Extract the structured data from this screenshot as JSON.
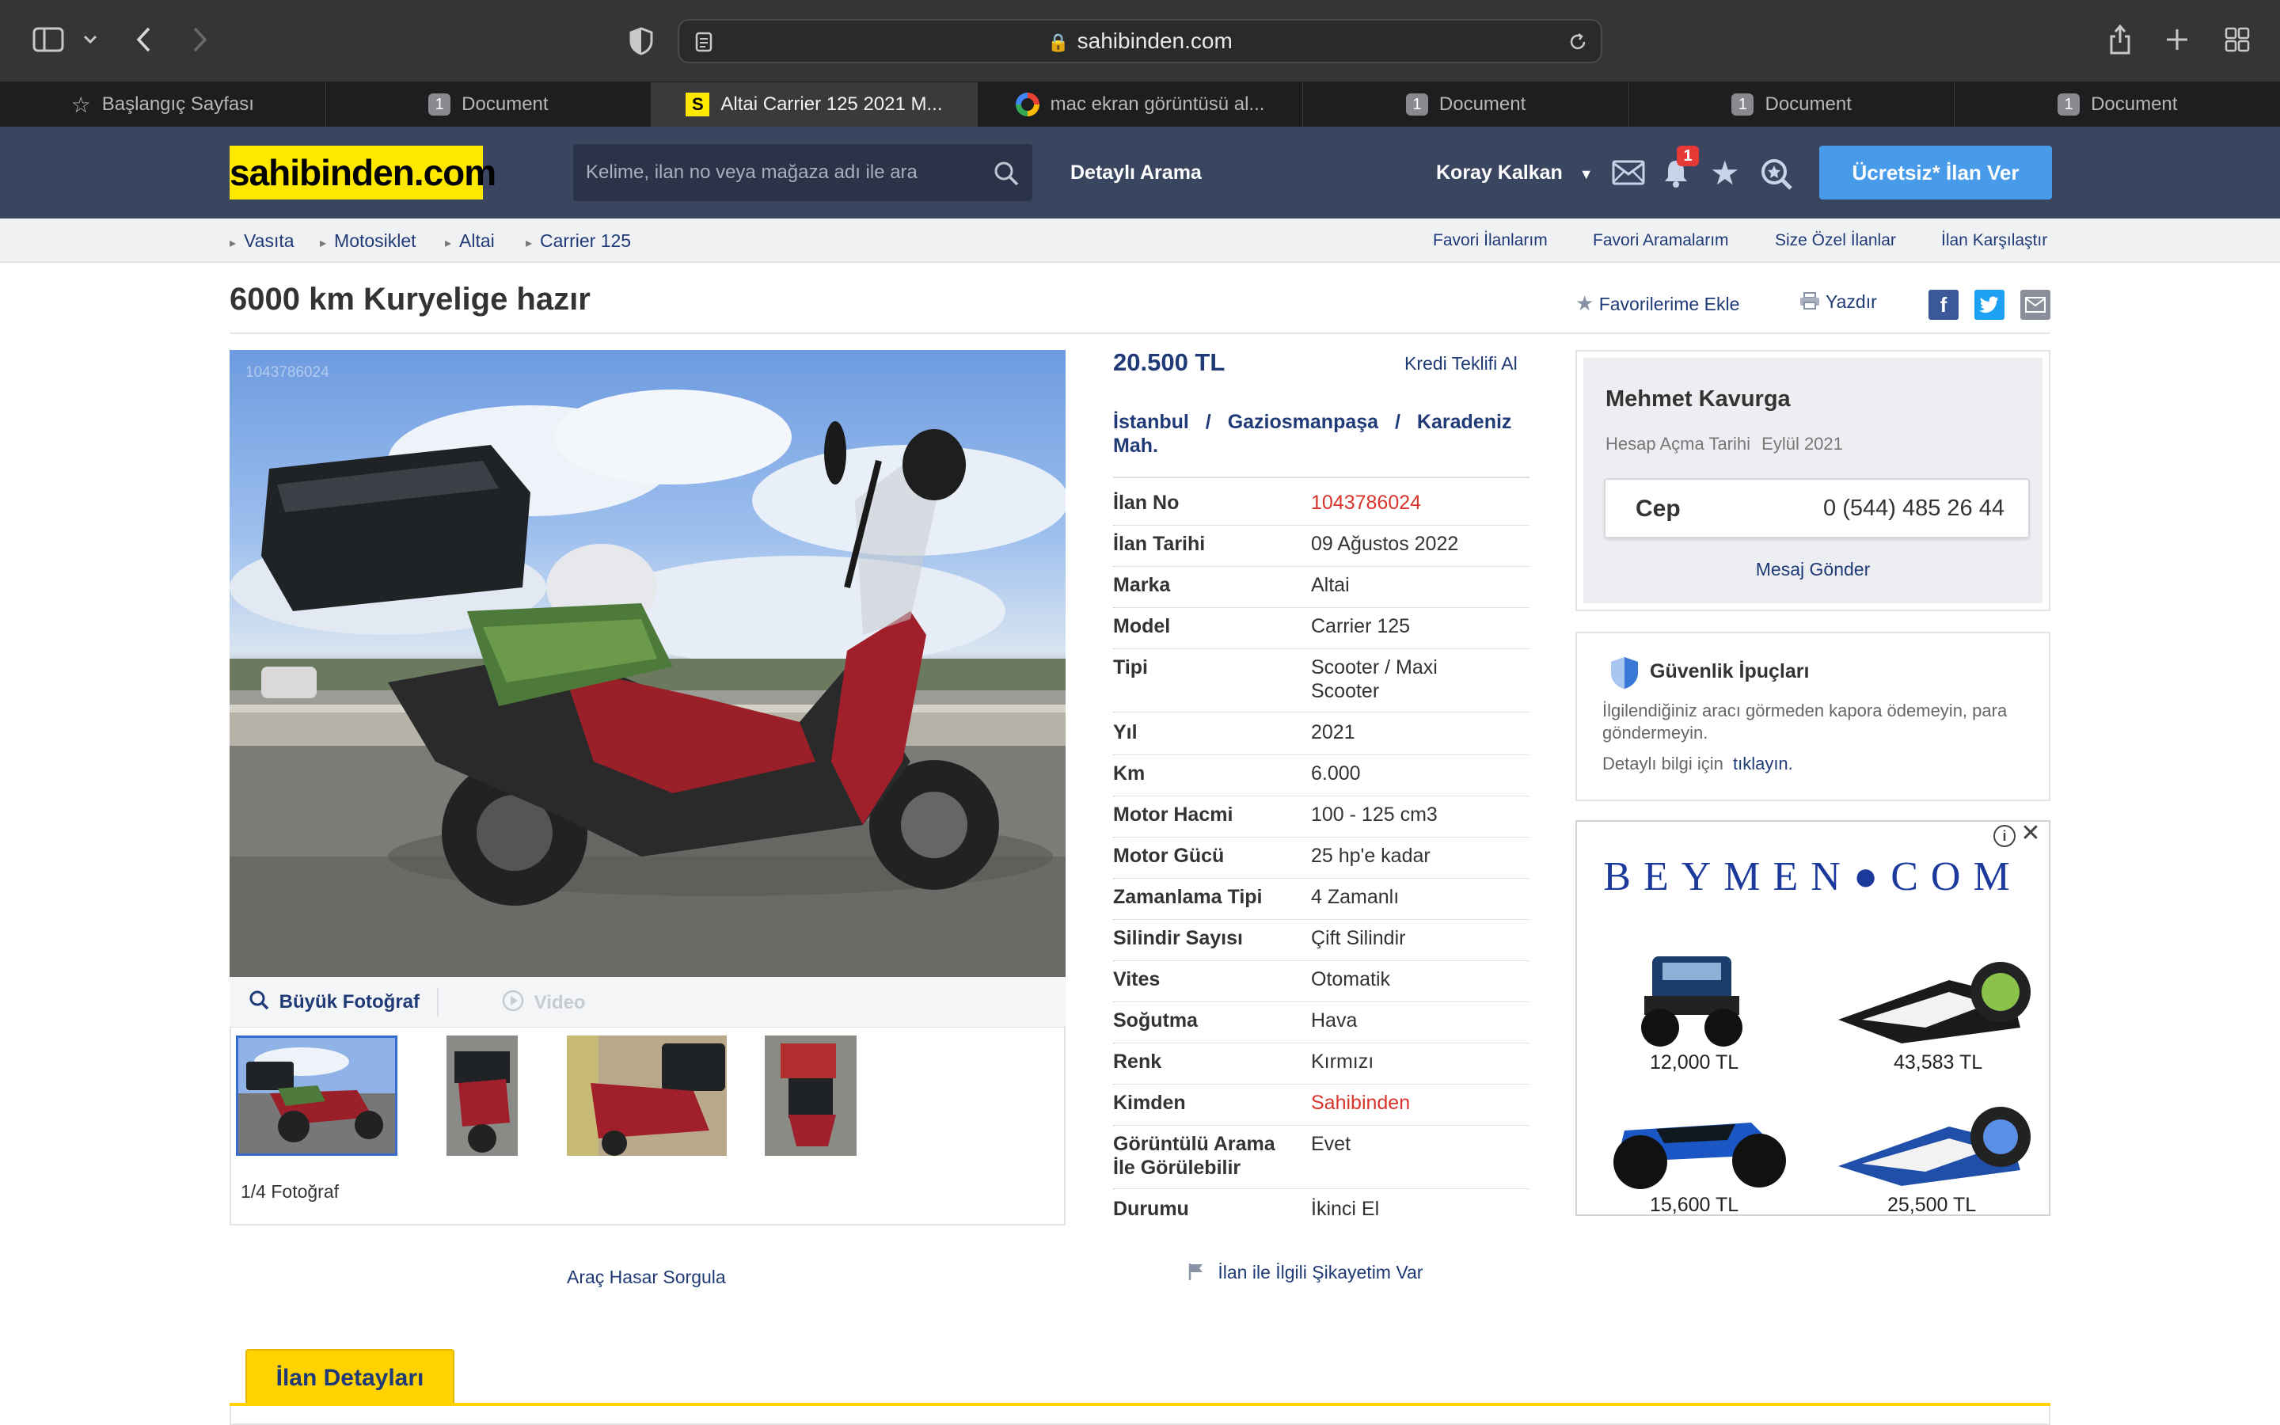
{
  "browser": {
    "url": "sahibinden.com",
    "tabs": [
      {
        "label": "Başlangıç Sayfası",
        "icon": "star-icon",
        "badge": ""
      },
      {
        "label": "Document",
        "icon": "badge",
        "badge": "1"
      },
      {
        "label": "Altai Carrier 125 2021 M...",
        "icon": "sahibinden-favicon",
        "badge": "S"
      },
      {
        "label": "mac ekran görüntüsü al...",
        "icon": "google-favicon",
        "badge": ""
      },
      {
        "label": "Document",
        "icon": "badge",
        "badge": "1"
      },
      {
        "label": "Document",
        "icon": "badge",
        "badge": "1"
      },
      {
        "label": "Document",
        "icon": "badge",
        "badge": "1"
      }
    ]
  },
  "header": {
    "logo": "sahibinden.com",
    "search_placeholder": "Kelime, ilan no veya mağaza adı ile ara",
    "detailed_search": "Detaylı Arama",
    "user": "Koray Kalkan",
    "notification_count": "1",
    "cta": "Ücretsiz* İlan Ver"
  },
  "breadcrumb": [
    "Vasıta",
    "Motosiklet",
    "Altai",
    "Carrier 125"
  ],
  "quick_links": [
    "Favori İlanlarım",
    "Favori Aramalarım",
    "Size Özel İlanlar",
    "İlan Karşılaştır"
  ],
  "listing": {
    "title": "6000 km Kuryelige hazır",
    "add_favorite": "Favorilerime Ekle",
    "print": "Yazdır",
    "photo_id": "1043786024",
    "big_photo": "Büyük Fotoğraf",
    "video": "Video",
    "photo_count": "1/4 Fotoğraf",
    "damage_query": "Araç Hasar Sorgula",
    "price": "20.500 TL",
    "credit_offer": "Kredi Teklifi Al",
    "location": {
      "city": "İstanbul",
      "district": "Gaziosmanpaşa",
      "neighborhood": "Karadeniz Mah."
    },
    "complaint": "İlan ile İlgili Şikayetim Var",
    "details_tab": "İlan Detayları"
  },
  "specs": [
    {
      "label": "İlan No",
      "value": "1043786024",
      "highlight": true
    },
    {
      "label": "İlan Tarihi",
      "value": "09 Ağustos 2022"
    },
    {
      "label": "Marka",
      "value": "Altai"
    },
    {
      "label": "Model",
      "value": "Carrier 125"
    },
    {
      "label": "Tipi",
      "value": "Scooter / Maxi Scooter"
    },
    {
      "label": "Yıl",
      "value": "2021"
    },
    {
      "label": "Km",
      "value": "6.000"
    },
    {
      "label": "Motor Hacmi",
      "value": "100 - 125 cm3"
    },
    {
      "label": "Motor Gücü",
      "value": "25 hp'e kadar"
    },
    {
      "label": "Zamanlama Tipi",
      "value": "4 Zamanlı"
    },
    {
      "label": "Silindir Sayısı",
      "value": "Çift Silindir"
    },
    {
      "label": "Vites",
      "value": "Otomatik"
    },
    {
      "label": "Soğutma",
      "value": "Hava"
    },
    {
      "label": "Renk",
      "value": "Kırmızı"
    },
    {
      "label": "Kimden",
      "value": "Sahibinden",
      "highlight": true
    },
    {
      "label": "Görüntülü Arama İle Görülebilir",
      "value": "Evet"
    },
    {
      "label": "Durumu",
      "value": "İkinci El"
    }
  ],
  "seller": {
    "name": "Mehmet Kavurga",
    "joined_label": "Hesap Açma Tarihi",
    "joined": "Eylül 2021",
    "phone_label": "Cep",
    "phone": "0 (544) 485 26 44",
    "message": "Mesaj Gönder"
  },
  "safety": {
    "title": "Güvenlik İpuçları",
    "text": "İlgilendiğiniz aracı görmeden kapora ödemeyin, para göndermeyin.",
    "more_prefix": "Detaylı bilgi için",
    "more_link": "tıklayın."
  },
  "ad": {
    "brand": "BEYMEN●COM",
    "prices": [
      "12,000 TL",
      "43,583 TL",
      "15,600 TL",
      "25,500 TL"
    ]
  },
  "colors": {
    "header_bg": "#3a4660",
    "logo_bg": "#ffe800",
    "link": "#1f3a76",
    "cta": "#489be8",
    "accent_red": "#d8342b",
    "tab_yellow": "#ffd200"
  }
}
